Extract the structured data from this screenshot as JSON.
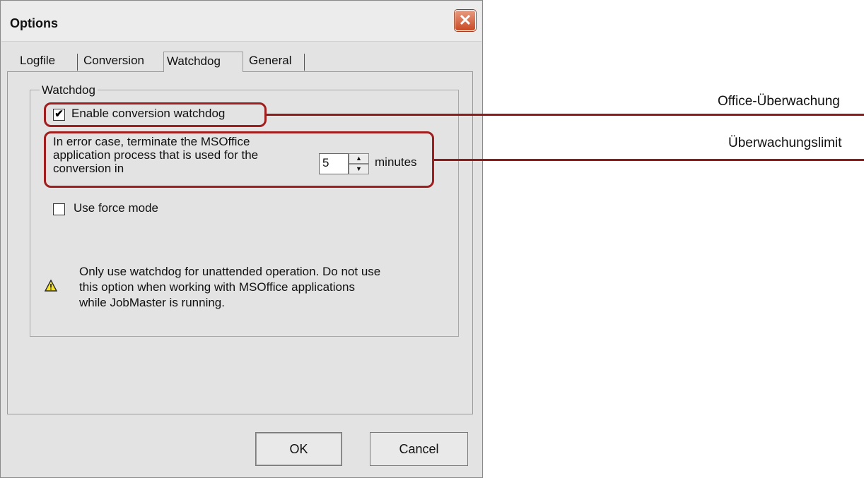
{
  "window": {
    "title": "Options"
  },
  "tabs": [
    {
      "label": "Logfile"
    },
    {
      "label": "Conversion"
    },
    {
      "label": "Watchdog"
    },
    {
      "label": "General"
    }
  ],
  "active_tab": "Watchdog",
  "group": {
    "title": "Watchdog",
    "enable_watchdog": {
      "label": "Enable conversion watchdog",
      "checked": true
    },
    "terminate": {
      "lines": [
        "In error case, terminate the MSOffice",
        "application process that is used for the",
        "conversion in"
      ],
      "value": "5",
      "unit": "minutes"
    },
    "force_mode": {
      "label": "Use force mode",
      "checked": false
    },
    "warning": {
      "icon": "warning-icon",
      "lines": [
        "Only use watchdog for unattended operation. Do not use",
        "this option when working with MSOffice applications",
        "while JobMaster is running."
      ]
    }
  },
  "buttons": {
    "ok": "OK",
    "cancel": "Cancel"
  },
  "annotations": [
    {
      "label": "Office-Überwachung"
    },
    {
      "label": "Überwachungslimit"
    }
  ],
  "colors": {
    "highlight": "#a01e1e",
    "close_button": "#c94a25"
  }
}
